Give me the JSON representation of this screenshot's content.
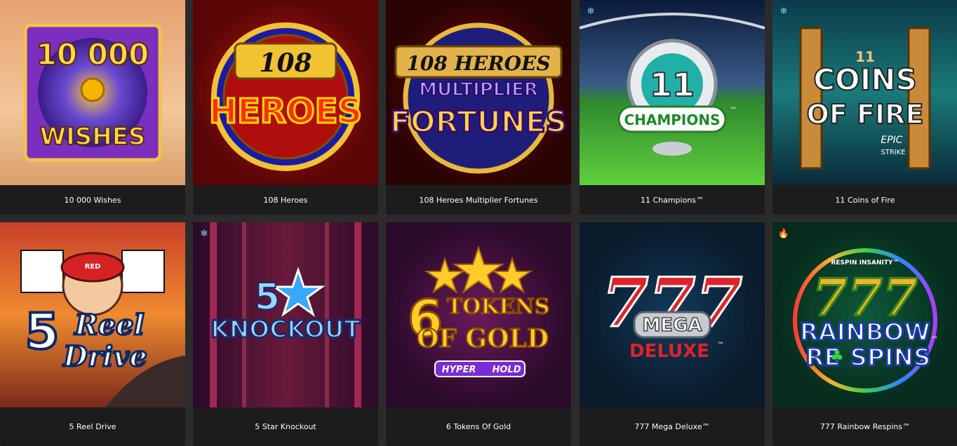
{
  "games": [
    {
      "title": "10 000 Wishes",
      "logo_lines": [
        "10 000",
        "WISHES"
      ],
      "badge": null
    },
    {
      "title": "108 Heroes",
      "logo_lines": [
        "108",
        "HEROES"
      ],
      "badge": null
    },
    {
      "title": "108 Heroes Multiplier Fortunes",
      "logo_lines": [
        "108 HEROES",
        "MULTIPLIER",
        "FORTUNES"
      ],
      "badge": null
    },
    {
      "title": "11 Champions™",
      "logo_lines": [
        "11",
        "CHAMPIONS",
        "™"
      ],
      "badge": "snowflake-icon"
    },
    {
      "title": "11 Coins of Fire",
      "logo_lines": [
        "11",
        "COINS",
        "OF FIRE",
        "EPIC",
        "STRIKE"
      ],
      "badge": "snowflake-icon"
    },
    {
      "title": "5 Reel Drive",
      "logo_lines": [
        "5",
        "Reel",
        "Drive",
        "RED"
      ],
      "badge": null
    },
    {
      "title": "5 Star Knockout",
      "logo_lines": [
        "5",
        "KNOCKOUT"
      ],
      "badge": "snowflake-icon"
    },
    {
      "title": "6 Tokens Of Gold",
      "logo_lines": [
        "6",
        "TOKENS",
        "OF GOLD",
        "HYPER",
        "HOLD"
      ],
      "badge": null
    },
    {
      "title": "777 Mega Deluxe™",
      "logo_lines": [
        "777",
        "MEGA",
        "DELUXE",
        "™"
      ],
      "badge": null
    },
    {
      "title": "777 Rainbow Respins™",
      "logo_lines": [
        "RESPIN INSANITY™",
        "777",
        "RAINBOW",
        "RE",
        "SPINS",
        "™"
      ],
      "badge": "fire-icon"
    }
  ],
  "badge_glyphs": {
    "snowflake-icon": "❄",
    "fire-icon": "🔥"
  }
}
